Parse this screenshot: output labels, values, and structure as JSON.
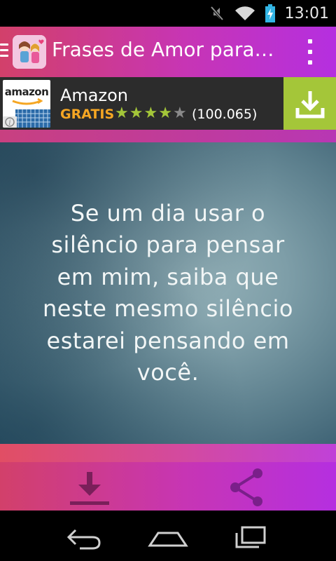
{
  "status_bar": {
    "time": "13:01",
    "icons": [
      "mute-icon",
      "wifi-icon",
      "battery-charging-icon"
    ]
  },
  "app_bar": {
    "title": "Frases de Amor para…",
    "icons": [
      "hamburger-icon",
      "app-logo-icon",
      "overflow-menu-icon"
    ]
  },
  "ad": {
    "brand_logo_text": "amazon",
    "title": "Amazon",
    "price_label": "GRATIS",
    "rating": 4,
    "rating_max": 5,
    "review_count": "(100.065)",
    "install_icon": "download-icon",
    "accent_color": "#a4c639"
  },
  "quote": {
    "text": "Se um dia usar o silêncio para pensar em mim, saiba que neste mesmo silêncio estarei pensando em você."
  },
  "actions": {
    "download_icon": "download-icon",
    "share_icon": "share-icon"
  },
  "nav_bar": {
    "icons": [
      "back-icon",
      "home-icon",
      "recent-apps-icon"
    ]
  },
  "colors": {
    "gradient_start": "#d2406a",
    "gradient_end": "#b52fe0",
    "ad_background": "#2c2c2c",
    "ad_price": "#f5a623"
  }
}
